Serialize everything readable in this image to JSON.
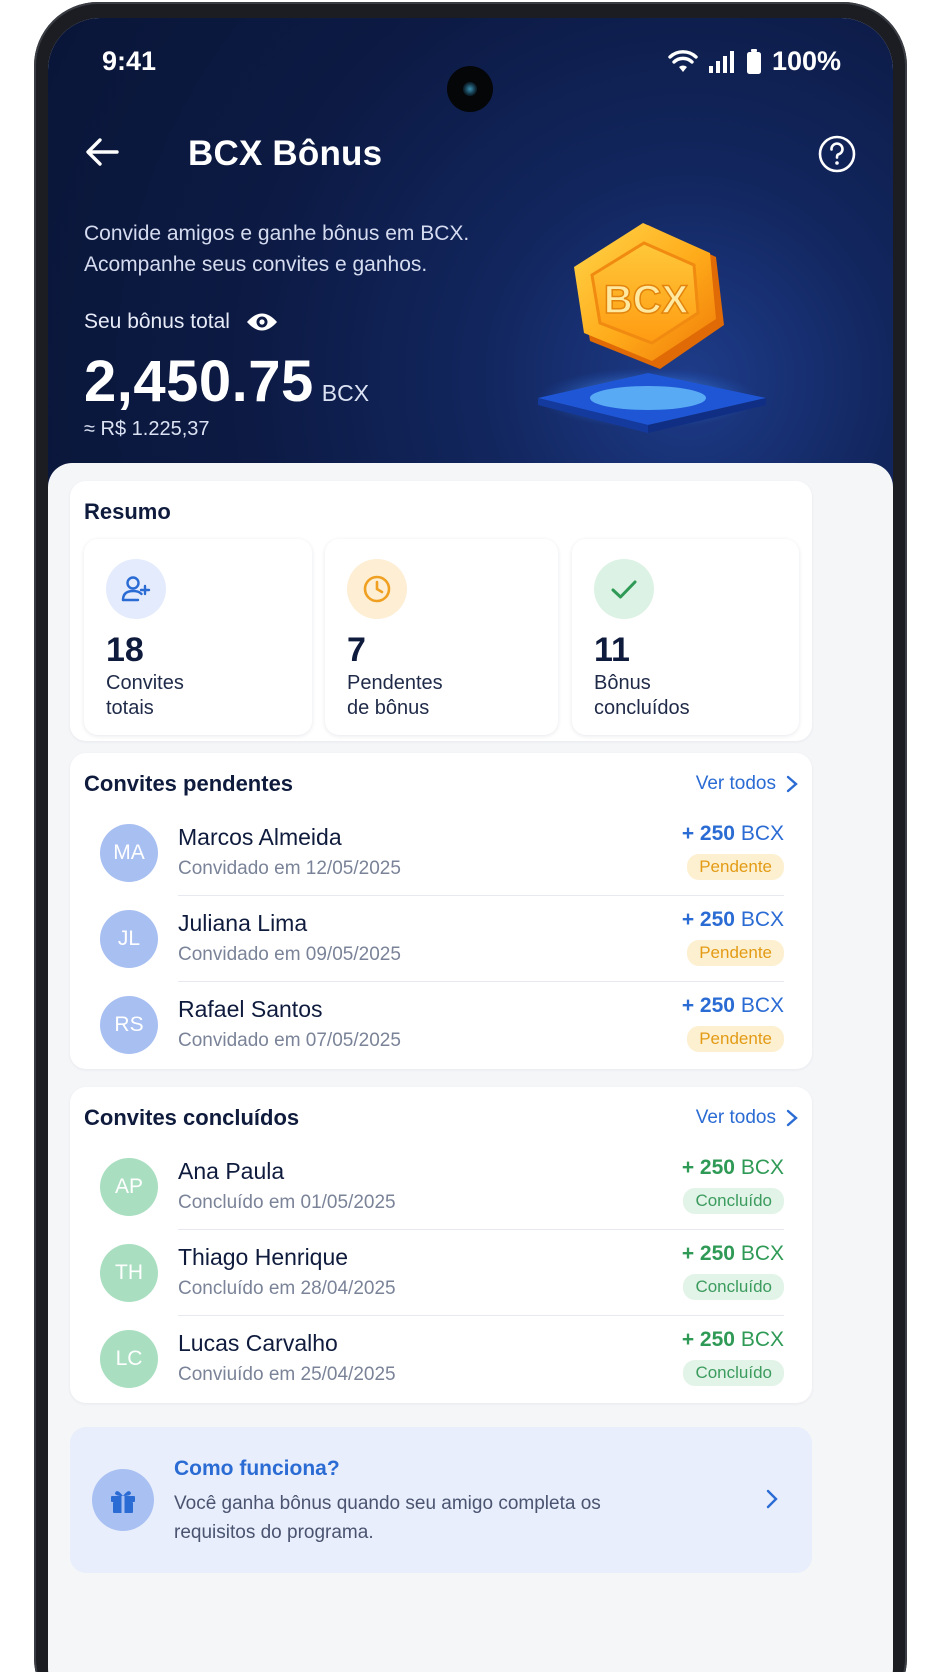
{
  "status_bar": {
    "time": "9:41",
    "battery": "100%"
  },
  "header": {
    "title": "BCX Bônus",
    "intro": "Convide amigos e ganhe bônus em BCX. Acompanhe seus convites e ganhos.",
    "bonus_label": "Seu bônus total",
    "bonus_amount": "2,450.75",
    "bonus_unit": "BCX",
    "bonus_brl": "≈ R$ 1.225,37",
    "coin_text": "BCX"
  },
  "summary": {
    "title": "Resumo",
    "stats": [
      {
        "value": "18",
        "label": "Convites totais",
        "icon": "user-plus-icon"
      },
      {
        "value": "7",
        "label": "Pendentes de bônus",
        "icon": "clock-icon"
      },
      {
        "value": "11",
        "label": "Bônus concluídos",
        "icon": "check-icon"
      }
    ]
  },
  "pending": {
    "title": "Convites pendentes",
    "see_all": "Ver todos",
    "items": [
      {
        "initials": "MA",
        "name": "Marcos Almeida",
        "date": "Convidado em 12/05/2025",
        "amount": "+ 250",
        "unit": "BCX",
        "status": "Pendente"
      },
      {
        "initials": "JL",
        "name": "Juliana Lima",
        "date": "Convidado em 09/05/2025",
        "amount": "+ 250",
        "unit": "BCX",
        "status": "Pendente"
      },
      {
        "initials": "RS",
        "name": "Rafael Santos",
        "date": "Convidado em 07/05/2025",
        "amount": "+ 250",
        "unit": "BCX",
        "status": "Pendente"
      }
    ]
  },
  "completed": {
    "title": "Convites concluídos",
    "see_all": "Ver todos",
    "items": [
      {
        "initials": "AP",
        "name": "Ana Paula",
        "date": "Concluído em 01/05/2025",
        "amount": "+ 250",
        "unit": "BCX",
        "status": "Concluído"
      },
      {
        "initials": "TH",
        "name": "Thiago Henrique",
        "date": "Concluído em 28/04/2025",
        "amount": "+ 250",
        "unit": "BCX",
        "status": "Concluído"
      },
      {
        "initials": "LC",
        "name": "Lucas Carvalho",
        "date": "Conviuído em 25/04/2025",
        "amount": "+ 250",
        "unit": "BCX",
        "status": "Concluído"
      }
    ]
  },
  "how_it_works": {
    "title": "Como funciona?",
    "description": "Você ganha bônus quando seu amigo completa os requisitos do programa."
  },
  "colors": {
    "hero_bg": "#0c1a44",
    "accent_blue": "#2a6bd4",
    "pending_orange": "#e39b15",
    "completed_green": "#2f9a56"
  }
}
